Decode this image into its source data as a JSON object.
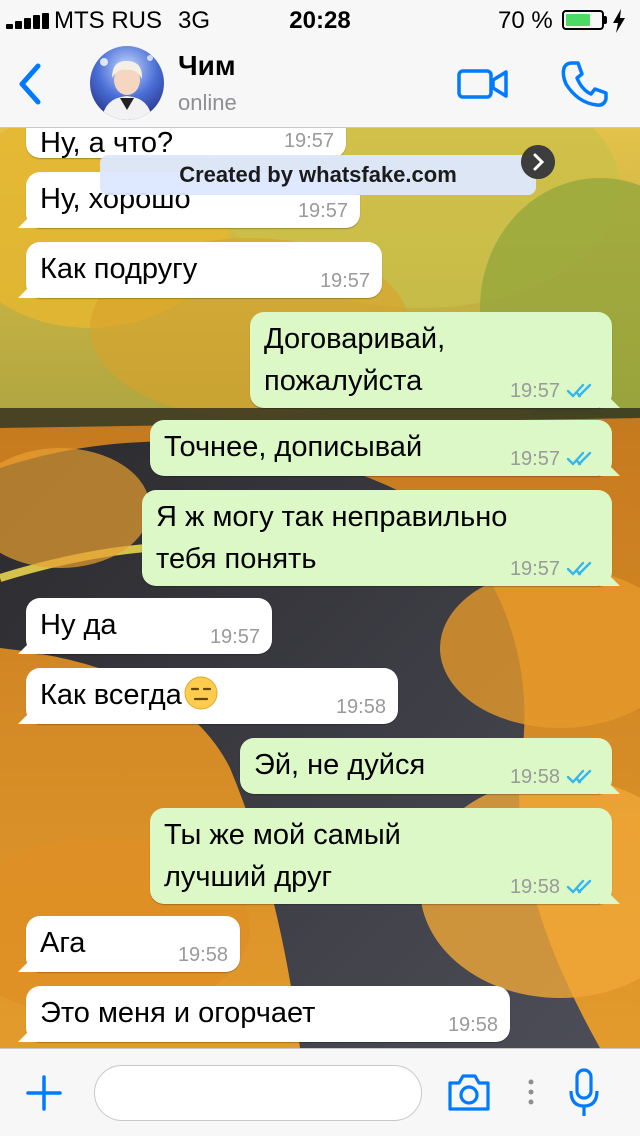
{
  "status_bar": {
    "carrier": "MTS RUS",
    "network": "3G",
    "time": "20:28",
    "battery_percent": "70 %",
    "battery_level": 0.7,
    "icons": [
      "signal-icon",
      "battery-icon",
      "charging-icon"
    ]
  },
  "header": {
    "contact_name": "Чим",
    "contact_status": "online",
    "icons": [
      "back-icon",
      "avatar",
      "video-call-icon",
      "phone-call-icon"
    ]
  },
  "watermark": {
    "text": "Created by whatsfake.com"
  },
  "messages": [
    {
      "dir": "in",
      "lines": [
        "Ну, а что?"
      ],
      "time": "19:57"
    },
    {
      "dir": "in",
      "lines": [
        "Ну, хорошо"
      ],
      "time": "19:57"
    },
    {
      "dir": "in",
      "lines": [
        "Как подругу"
      ],
      "time": "19:57"
    },
    {
      "dir": "out",
      "lines": [
        "Договаривай,",
        "пожалуйста"
      ],
      "time": "19:57",
      "read": true
    },
    {
      "dir": "out",
      "lines": [
        "Точнее, дописывай"
      ],
      "time": "19:57",
      "read": true
    },
    {
      "dir": "out",
      "lines": [
        "Я ж могу так неправильно",
        "тебя понять"
      ],
      "time": "19:57",
      "read": true
    },
    {
      "dir": "in",
      "lines": [
        "Ну да"
      ],
      "time": "19:57"
    },
    {
      "dir": "in",
      "lines": [
        "Как всегда"
      ],
      "emoji": "expressionless-face-emoji",
      "time": "19:58"
    },
    {
      "dir": "out",
      "lines": [
        "Эй, не дуйся"
      ],
      "time": "19:58",
      "read": true
    },
    {
      "dir": "out",
      "lines": [
        "Ты же мой самый",
        "лучший друг"
      ],
      "time": "19:58",
      "read": true
    },
    {
      "dir": "in",
      "lines": [
        "Ага"
      ],
      "time": "19:58"
    },
    {
      "dir": "in",
      "lines": [
        "Это меня и огорчает"
      ],
      "time": "19:58"
    }
  ],
  "input_bar": {
    "placeholder": "",
    "value": "",
    "icons": [
      "plus-icon",
      "camera-icon",
      "microphone-icon"
    ]
  },
  "colors": {
    "accent": "#007aff",
    "outgoing_bubble": "#dcf8c6",
    "incoming_bubble": "#ffffff",
    "read_ticks": "#34b7f1",
    "battery_fill": "#4cd964"
  }
}
